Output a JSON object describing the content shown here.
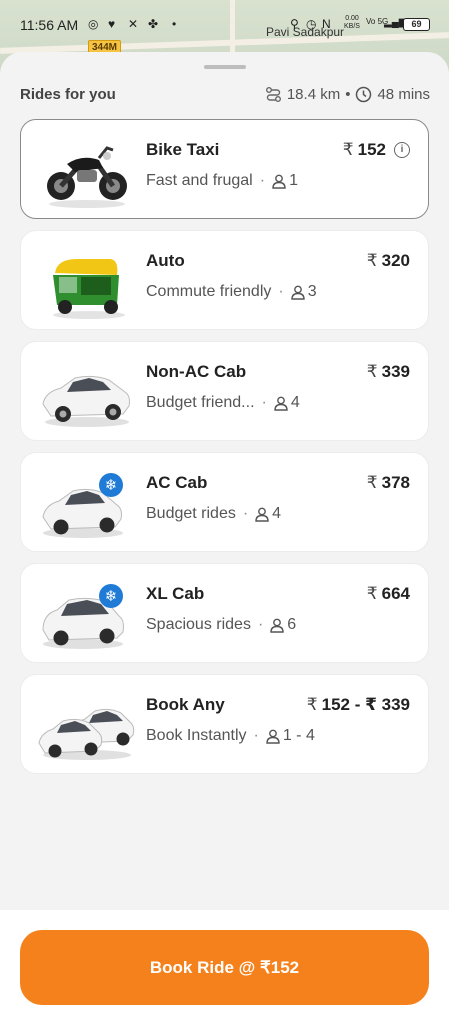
{
  "status_bar": {
    "time": "11:56 AM",
    "network": "0.00 KB/S",
    "carrier": "Vo 5G",
    "battery": "69"
  },
  "map": {
    "route_badge": "344M",
    "place": "Pavi Sadakpur"
  },
  "sheet": {
    "title": "Rides for you",
    "distance": "18.4 km",
    "separator": "•",
    "duration": "48 mins"
  },
  "rides": [
    {
      "name": "Bike Taxi",
      "tagline": "Fast and frugal",
      "seats": "1",
      "currency": "₹",
      "price": "152",
      "selected": true,
      "icon": "bike-icon"
    },
    {
      "name": "Auto",
      "tagline": "Commute friendly",
      "seats": "3",
      "currency": "₹",
      "price": "320",
      "selected": false,
      "icon": "auto-rickshaw-icon"
    },
    {
      "name": "Non-AC Cab",
      "tagline": "Budget friend...",
      "seats": "4",
      "currency": "₹",
      "price": "339",
      "selected": false,
      "icon": "car-icon"
    },
    {
      "name": "AC Cab",
      "tagline": "Budget rides",
      "seats": "4",
      "currency": "₹",
      "price": "378",
      "selected": false,
      "icon": "ac-car-icon"
    },
    {
      "name": "XL Cab",
      "tagline": "Spacious rides",
      "seats": "6",
      "currency": "₹",
      "price": "664",
      "selected": false,
      "icon": "ac-suv-icon"
    },
    {
      "name": "Book Any",
      "tagline": "Book Instantly",
      "seats": "1 - 4",
      "currency": "₹",
      "price": "152 - ₹ 339",
      "selected": false,
      "icon": "two-cars-icon"
    }
  ],
  "cta": {
    "label": "Book Ride @ ₹152"
  },
  "colors": {
    "accent": "#f5811c",
    "sheet_bg": "#f3f3f3",
    "card_bg": "#ffffff"
  }
}
